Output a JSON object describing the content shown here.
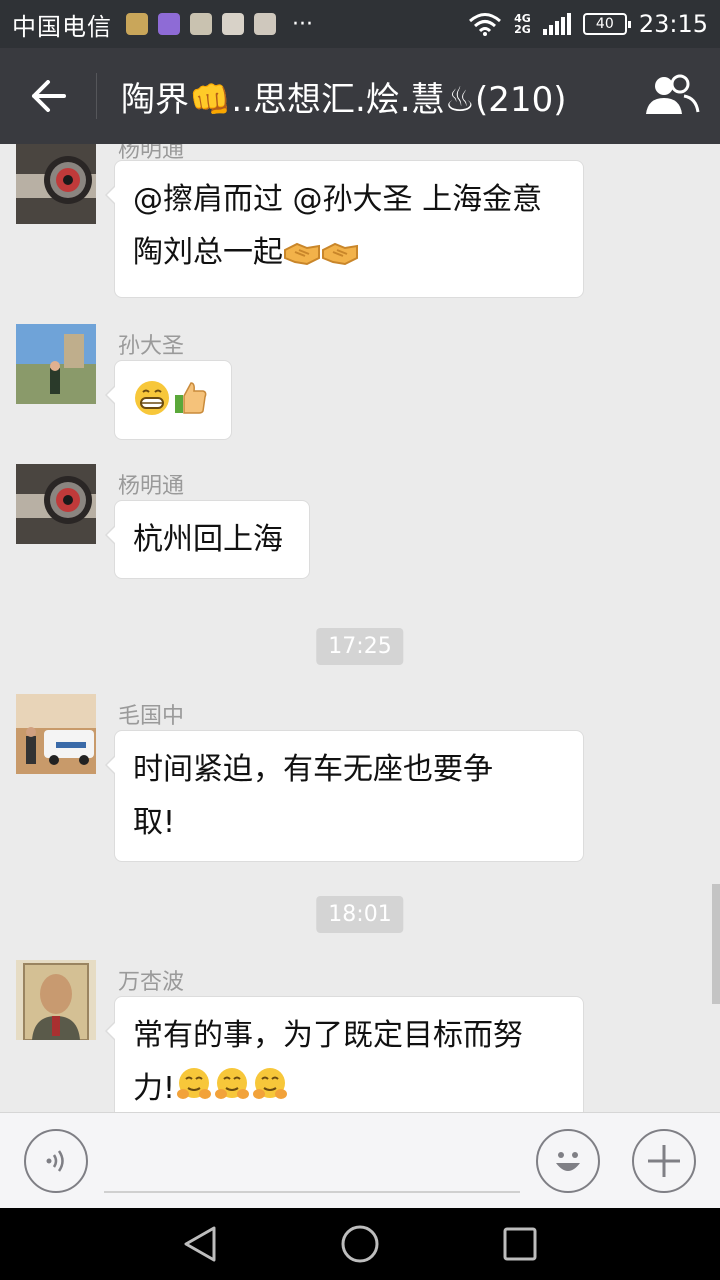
{
  "status_bar": {
    "carrier": "中国电信",
    "more": "···",
    "network_top": "4G",
    "network_bottom": "2G",
    "battery": "40",
    "time": "23:15"
  },
  "header": {
    "title": "陶界👊..思想汇.烩.慧♨(210)"
  },
  "messages": [
    {
      "sender": "杨明通",
      "lines": [
        "@擦肩而过 @孙大圣 上海金意",
        "陶刘总一起"
      ],
      "emojis": [
        "handshake",
        "handshake"
      ]
    },
    {
      "sender": "孙大圣",
      "emojis": [
        "grin",
        "thumbs-up"
      ]
    },
    {
      "sender": "杨明通",
      "lines": [
        "杭州回上海"
      ]
    },
    {
      "timestamp": "17:25"
    },
    {
      "sender": "毛国中",
      "lines": [
        "时间紧迫，有车无座也要争",
        "取!"
      ]
    },
    {
      "timestamp": "18:01"
    },
    {
      "sender": "万杏波",
      "lines": [
        "常有的事，为了既定目标而努",
        "力!"
      ],
      "emojis": [
        "hug",
        "hug",
        "hug"
      ]
    }
  ],
  "colors": {
    "status_bg": "#2f3236",
    "title_bg": "#393a3f",
    "chat_bg": "#ebebeb",
    "bubble_bg": "#ffffff",
    "timestamp_bg": "#d4d4d4"
  },
  "icons": {
    "back": "back-arrow-icon",
    "group": "group-members-icon",
    "voice": "voice-icon",
    "emoji": "emoji-face-icon",
    "plus": "plus-icon",
    "nav_back": "triangle-back-icon",
    "nav_home": "circle-home-icon",
    "nav_recent": "square-recent-icon"
  }
}
